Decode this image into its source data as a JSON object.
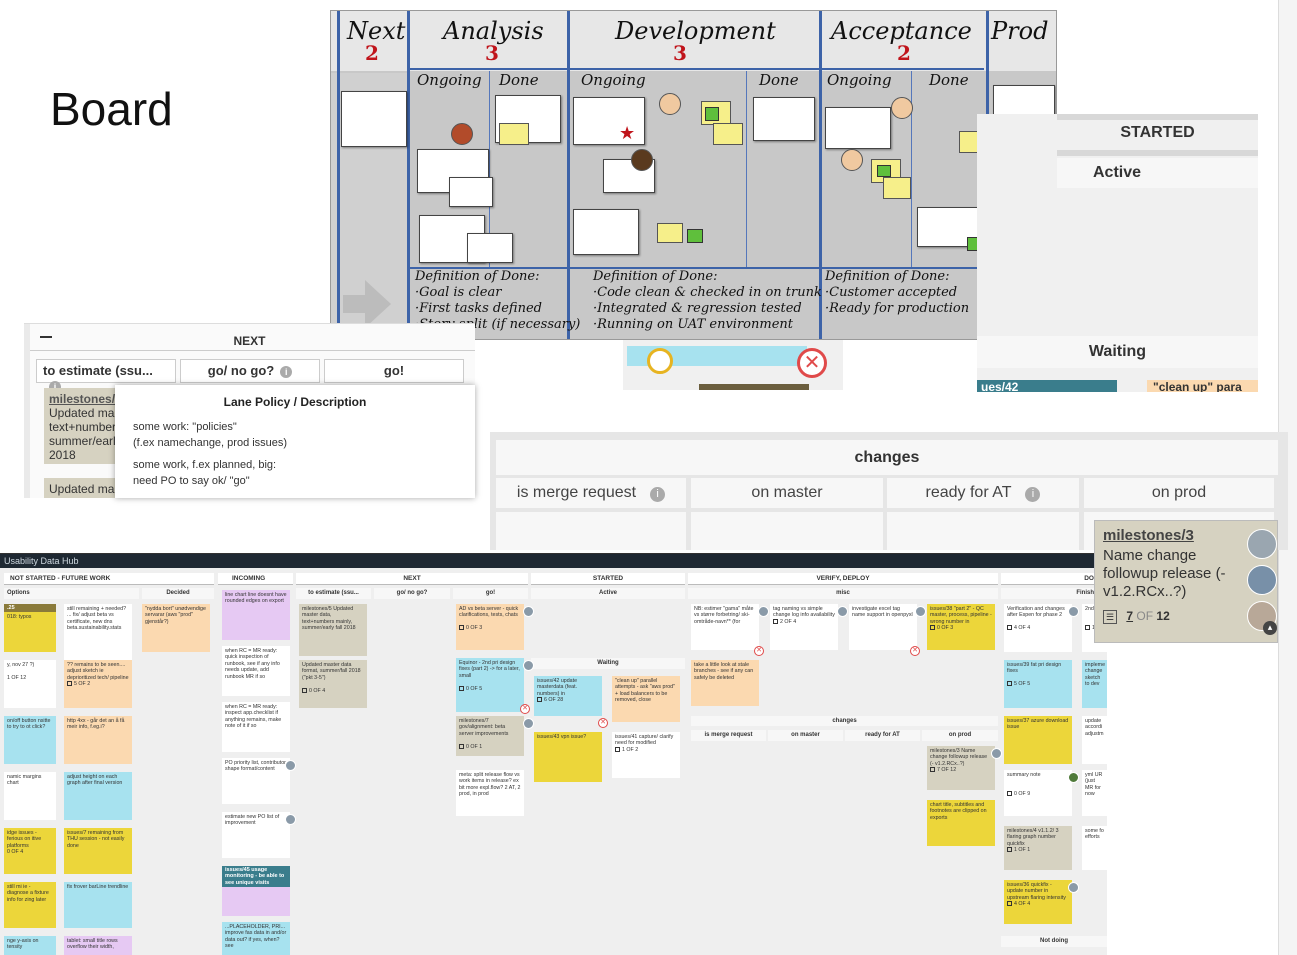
{
  "title": "Board",
  "photo": {
    "columns": [
      {
        "name": "Next",
        "wip": "2"
      },
      {
        "name": "Analysis",
        "wip": "3"
      },
      {
        "name": "Development",
        "wip": "3"
      },
      {
        "name": "Acceptance",
        "wip": "2"
      },
      {
        "name": "Prod",
        "wip": ""
      }
    ],
    "subcolumns": [
      "Ongoing",
      "Done",
      "Ongoing",
      "Done",
      "Ongoing",
      "Done"
    ],
    "dod": [
      "Definition of Done:\n·Goal is clear\n·First tasks defined\n·Story split (if necessary)",
      "Definition of Done:\n·Code clean & checked in on trunk\n·Integrated & regression tested\n·Running on UAT environment",
      "Definition of Done:\n·Customer accepted\n·Ready for production"
    ]
  },
  "zoom_left": {
    "group": "NEXT",
    "lanes": [
      "to estimate (ssu...",
      "go/ no go?",
      "go!"
    ],
    "card_title": "milestones/",
    "card_text": "Updated ma text+number summer/earl 2018",
    "card_text2": "Updated ma"
  },
  "tooltip": {
    "title": "Lane Policy / Description",
    "line1": "some work: \"policies\"",
    "line2": "(f.ex namechange, prod issues)",
    "line3": "some work, f.ex planned, big:",
    "line4": "need PO to say ok/ \"go\""
  },
  "zoom_right": {
    "group": "STARTED",
    "lane": "Active",
    "lane2": "Waiting",
    "card_frag": "ues/42",
    "card_frag2": "\"clean up\" para"
  },
  "changes": {
    "title": "changes",
    "lanes": [
      "is merge request",
      "on master",
      "ready for AT",
      "on prod"
    ]
  },
  "bigcard": {
    "title": "milestones/3",
    "text": "Name change followup release (- v1.2.RCx..?)",
    "progress_done": "7",
    "progress_of": "OF",
    "progress_total": "12"
  },
  "full": {
    "topbar": "Usability Data Hub",
    "groups": [
      "NOT STARTED - FUTURE WORK",
      "INCOMING",
      "NEXT",
      "STARTED",
      "VERIFY, DEPLOY",
      "DONE"
    ],
    "lanes": [
      "Options",
      "Decided",
      "to estimate (ssu...",
      "go/ no go?",
      "go!",
      "Active",
      "misc",
      "Finished"
    ],
    "waiting": "Waiting",
    "changes": "changes",
    "changes_lanes": [
      "is merge request",
      "on master",
      "ready for AT",
      "on prod"
    ],
    "not_doing": "Not doing",
    "cards": {
      "a1": "018: typos",
      "a2": "still remaining + needed? ... fix/ adjust beta vs certificate, new dns beta.sustainability.stats",
      "a3": "\"nydda bort\" unødvendige servarar (aws \"prod\" gjenstår?)",
      "a4": "y, nov 27 ?)",
      "a5": "?? remains to be seen.... adjust sketch ie deprioritized tech/ pipeline",
      "a6": "on/off button nsitte to try to ot click?",
      "a7": "http 4xx - går det an å få meir info, f.eg.i?",
      "a8": "namic margins chart",
      "a9": "adjust height on each graph after final version",
      "a10": "idge issues - ferious on itive platforms",
      "a11": "issues/7 remaining from THU session - not easily done",
      "a12": "still mi ie - diagnose a fixture info for zing later",
      "a13": "fix frover barLine trendline",
      "a14": "nge y-axis on tensity",
      "a15": "tablet: small title rows overflow their width,",
      "i1": "line chart line doesnt have rounded edges on export",
      "i2": "when RC = MR ready: quick inspection of runbook, see if any info needs update, add runbook MR if so",
      "i3": "when RC = MR ready: inspect app.checklist if anything remains, make note of it if so",
      "i4": "PO priority list, contributor shape format/content",
      "i5": "estimate new PO list of improvement",
      "i6": "issues/45 usage monitoring - be able to see unique visits",
      "i7": "...PLACEHOLDER, PRI... improve fas data in and/or data out? if yes, when? see",
      "n1": "milestones/5 Updated master data, text+numbers mainly, summer/early fall 2018",
      "n2": "Updated master data format, summer/fall 2018 (\"pkt 3-5\")",
      "g1": "AD vs beta server - quick clarifications, tests, chats",
      "g2": "Equinor - 2nd pri design fixes (part 2) -> for a later, small",
      "g3": "milestones/7 gov/alignment: beta server improvements",
      "g4": "meta: split release flow vs work items in release? ex bit more expl.flow? 2 AT, 2 prod, in prod",
      "s1": "issues/42 update masterdata (feat. numbers) in",
      "s2": "\"clean up\" parallel attempts - ask \"aws prod\" + load balancers to be removed, close",
      "s3": "issues/43 vpn issue?",
      "s4": "issues/41 capture/ clarify need for modified",
      "v1": "NB: estimer \"gama\" måte vs større forbetring/ ski-omtråde-navn** (for",
      "v2": "tag naming vs simple change log info availability",
      "v3": "investigate excel tag name support in openpyxl",
      "v4": "issues/38 \"part 2\" - QC master, process, pipeline - wrong number in",
      "v5": "take a little look at stale branches - see if any can safely be deleted",
      "v6": "milestones/3 Name change followup release (- v1.2.RCx..?)",
      "v7": "chart title, subtitles and footnotes are clipped on exports",
      "d1": "Verification and changes after Espen for phase 2",
      "d2": "2nd pri",
      "d3": "issues/39 fat pri design fixes",
      "d4": "impleme change sketch to dev",
      "d5": "issues/37 azure download issue",
      "d6": "update accordi adjustm",
      "d7": "summary note",
      "d8": "yml UR (just MR for now",
      "d9": "milestones/4 v1.1.2/ 3 flaring graph number quickfix",
      "d10": "some fo efforts",
      "d11": "issues/36 quickfix - update number in upstream flaring intensity"
    },
    "progress": {
      "a1": "1 OF 12",
      "a5": "5 OF 2",
      "a10": "0 OF 4",
      "n1": "0 OF 4",
      "g1": "0 OF 3",
      "g2": "0 OF 5",
      "g3": "0 OF 1",
      "s1": "6 OF 28",
      "s4": "1 OF 2",
      "v2": "2 OF 4",
      "v4": "0 OF 3",
      "v6": "7 OF 12",
      "d1": "4 OF 4",
      "d3": "5 OF 5",
      "d7": "0 OF 9",
      "d9": "1 OF 1",
      "d11": "4 OF 4",
      "d2": "12"
    }
  }
}
